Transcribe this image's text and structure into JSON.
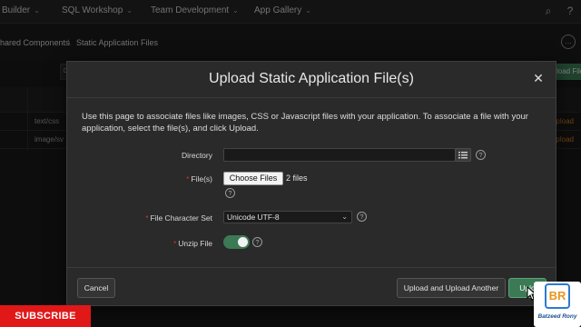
{
  "topnav": {
    "items": [
      "Builder",
      "SQL Workshop",
      "Team Development",
      "App Gallery"
    ]
  },
  "breadcrumb": {
    "items": [
      "hared Components",
      "Static Application Files"
    ],
    "separator": "\\"
  },
  "background": {
    "rows": [
      {
        "type": "text/css",
        "action": "Upload"
      },
      {
        "type": "image/sv",
        "action": "Upload"
      }
    ],
    "right_button": "load File",
    "left_button": "C"
  },
  "modal": {
    "title": "Upload Static Application File(s)",
    "intro": "Use this page to associate files like images, CSS or Javascript files with your application. To associate a file with your application, select the file(s), and click Upload.",
    "fields": {
      "directory": {
        "label": "Directory",
        "value": ""
      },
      "files": {
        "label": "File(s)",
        "button": "Choose Files",
        "status": "2 files",
        "required": true
      },
      "charset": {
        "label": "File Character Set",
        "value": "Unicode UTF-8",
        "required": true
      },
      "unzip": {
        "label": "Unzip File",
        "checked": true,
        "required": true
      }
    },
    "buttons": {
      "cancel": "Cancel",
      "upload_another": "Upload and Upload Another",
      "upload": "Uplo"
    }
  },
  "overlays": {
    "subscribe": "SUBSCRIBE",
    "logo_text": "Batzeed Rony",
    "logo_mark": "BR"
  },
  "colors": {
    "primary": "#3b7a55",
    "accent_orange": "#c8781e",
    "subscribe_red": "#e01818"
  }
}
